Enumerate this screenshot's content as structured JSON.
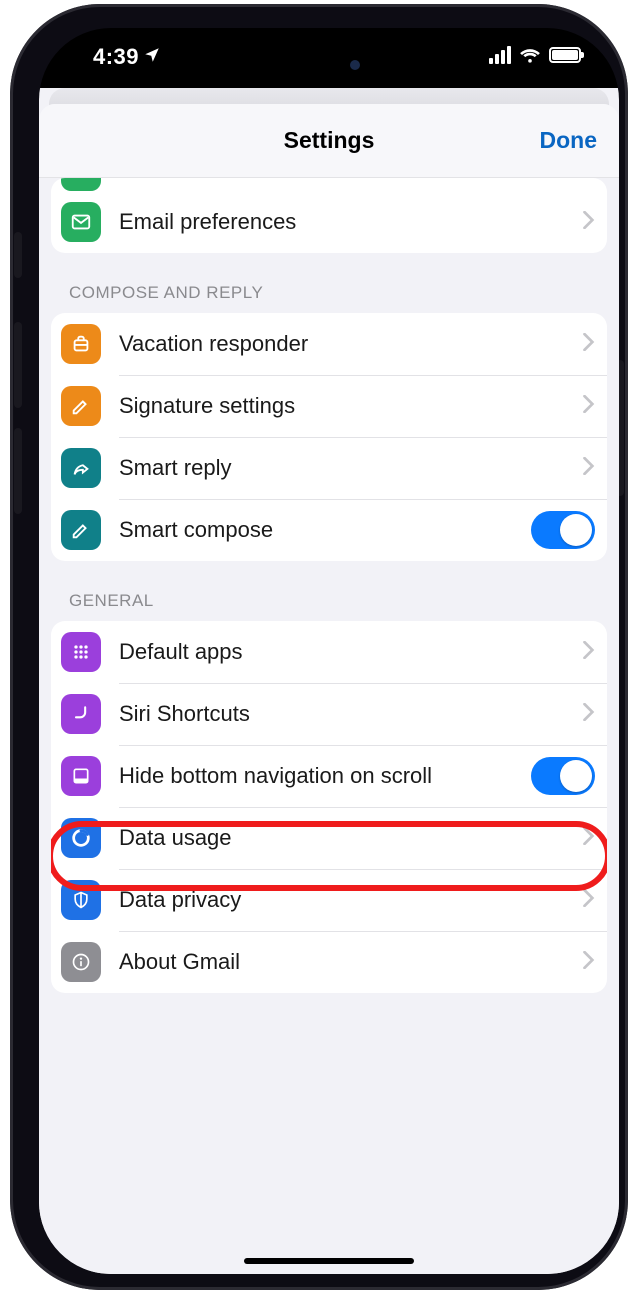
{
  "status": {
    "time": "4:39"
  },
  "header": {
    "title": "Settings",
    "done": "Done"
  },
  "partial_row": {
    "label": "Email preferences",
    "icon": "mail-icon",
    "color": "green"
  },
  "groups": [
    {
      "title": "COMPOSE AND REPLY",
      "rows": [
        {
          "label": "Vacation responder",
          "icon": "suitcase-icon",
          "color": "orange",
          "kind": "nav"
        },
        {
          "label": "Signature settings",
          "icon": "pencil-icon",
          "color": "orange",
          "kind": "nav"
        },
        {
          "label": "Smart reply",
          "icon": "reply-icon",
          "color": "teal",
          "kind": "nav"
        },
        {
          "label": "Smart compose",
          "icon": "edit-icon",
          "color": "teal",
          "kind": "toggle",
          "on": true
        }
      ]
    },
    {
      "title": "GENERAL",
      "rows": [
        {
          "label": "Default apps",
          "icon": "grid-icon",
          "color": "purple",
          "kind": "nav"
        },
        {
          "label": "Siri Shortcuts",
          "icon": "curve-icon",
          "color": "purple",
          "kind": "nav"
        },
        {
          "label": "Hide bottom navigation on scroll",
          "icon": "panel-icon",
          "color": "purple",
          "kind": "toggle",
          "on": true
        },
        {
          "label": "Data usage",
          "icon": "ring-icon",
          "color": "blue",
          "kind": "nav",
          "highlighted": true
        },
        {
          "label": "Data privacy",
          "icon": "shield-icon",
          "color": "blue",
          "kind": "nav"
        },
        {
          "label": "About Gmail",
          "icon": "info-icon",
          "color": "gray",
          "kind": "nav"
        }
      ]
    }
  ],
  "colors": {
    "accent_blue": "#0a7aff",
    "link_blue": "#0a66c2",
    "highlight_red": "#ef1c1c"
  }
}
